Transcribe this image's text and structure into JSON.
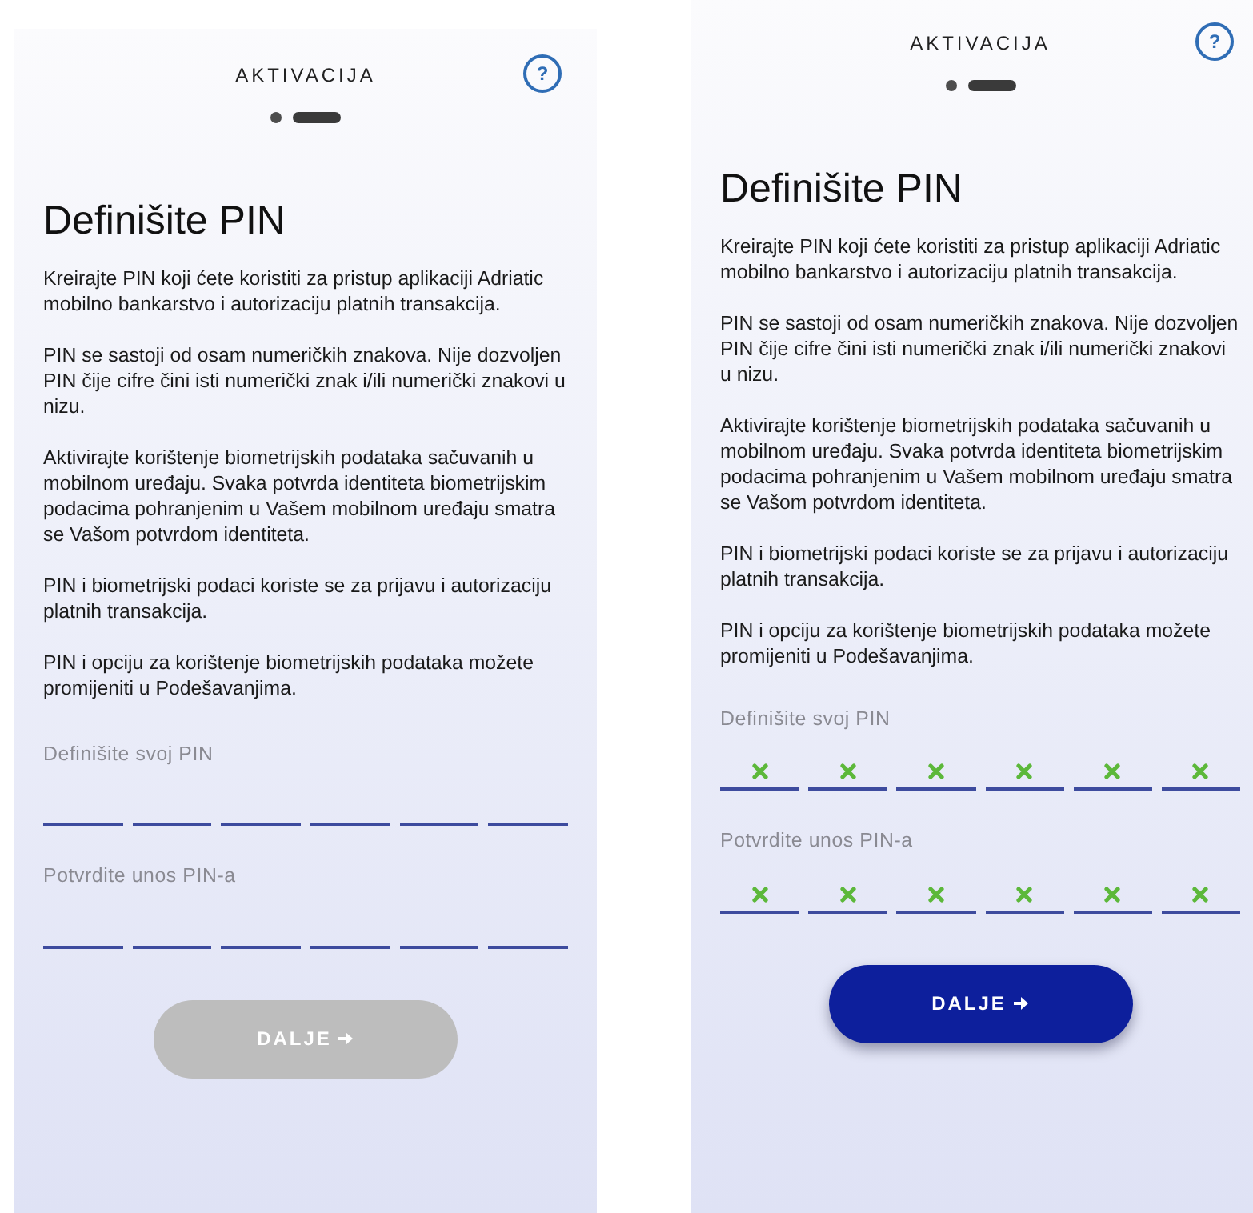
{
  "screens": [
    {
      "title": "AKTIVACIJA",
      "help": "?",
      "steps": [
        {
          "selected": false
        },
        {
          "selected": true
        }
      ],
      "heading": "Definišite PIN",
      "paragraphs": [
        "Kreirajte PIN koji ćete koristiti za pristup aplikaciji Adriatic mobilno bankarstvo i autorizaciju platnih transakcija.",
        "PIN se sastoji od osam numeričkih znakova. Nije dozvoljen PIN čije cifre čini isti numerički znak i/ili numerički znakovi u nizu.",
        "Aktivirajte korištenje biometrijskih podataka sačuvanih u mobilnom uređaju. Svaka potvrda identiteta biometrijskim podacima pohranjenim u Vašem mobilnom uređaju smatra se Vašom potvrdom identiteta.",
        "PIN i biometrijski podaci koriste se za prijavu i autorizaciju platnih transakcija.",
        "PIN i opciju za korištenje biometrijskih podataka možete promijeniti u Podešavanjima."
      ],
      "fields": [
        {
          "label": "Definišite svoj PIN",
          "slots": [
            {
              "filled": false
            },
            {
              "filled": false
            },
            {
              "filled": false
            },
            {
              "filled": false
            },
            {
              "filled": false
            },
            {
              "filled": false
            }
          ]
        },
        {
          "label": "Potvrdite unos PIN-a",
          "slots": [
            {
              "filled": false
            },
            {
              "filled": false
            },
            {
              "filled": false
            },
            {
              "filled": false
            },
            {
              "filled": false
            },
            {
              "filled": false
            }
          ]
        }
      ],
      "button": {
        "label": "DALJE",
        "disabled": true
      }
    },
    {
      "title": "AKTIVACIJA",
      "help": "?",
      "steps": [
        {
          "selected": false
        },
        {
          "selected": true
        }
      ],
      "heading": "Definišite PIN",
      "paragraphs": [
        "Kreirajte PIN koji ćete koristiti za pristup aplikaciji Adriatic mobilno bankarstvo i autorizaciju platnih transakcija.",
        "PIN se sastoji od osam numeričkih znakova. Nije dozvoljen PIN čije cifre čini isti numerički znak i/ili numerički znakovi u nizu.",
        "Aktivirajte korištenje biometrijskih podataka sačuvanih u mobilnom uređaju. Svaka potvrda identiteta biometrijskim podacima pohranjenim u Vašem mobilnom uređaju smatra se Vašom potvrdom identiteta.",
        "PIN i biometrijski podaci koriste se za prijavu i autorizaciju platnih transakcija.",
        "PIN i opciju za korištenje biometrijskih podataka možete promijeniti u Podešavanjima."
      ],
      "fields": [
        {
          "label": "Definišite svoj PIN",
          "slots": [
            {
              "filled": true
            },
            {
              "filled": true
            },
            {
              "filled": true
            },
            {
              "filled": true
            },
            {
              "filled": true
            },
            {
              "filled": true
            }
          ]
        },
        {
          "label": "Potvrdite unos PIN-a",
          "slots": [
            {
              "filled": true
            },
            {
              "filled": true
            },
            {
              "filled": true
            },
            {
              "filled": true
            },
            {
              "filled": true
            },
            {
              "filled": true
            }
          ]
        }
      ],
      "button": {
        "label": "DALJE",
        "disabled": false
      }
    }
  ]
}
